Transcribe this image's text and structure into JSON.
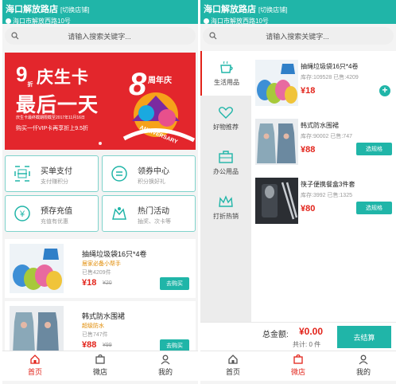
{
  "colors": {
    "brand": "#20b5a8",
    "price": "#e2231a",
    "banner": "#e3262c"
  },
  "left": {
    "header": {
      "title": "海口解放路店",
      "switch_label": "[切换店铺]",
      "address": "海口市解放西路10号"
    },
    "search": {
      "placeholder": "请输入搜索关键字..."
    },
    "banner": {
      "num": "9",
      "num_unit": "折",
      "line1": "庆生卡",
      "line2": "最后一天",
      "fine_print": "庆生卡最终截期限截至2017年11月16日",
      "promo": "购买一仟VIP卡再享折上9.5折",
      "anniv_num": "8",
      "anniv_text": "周年庆",
      "anniv_en": "ANNIVERSARY"
    },
    "tiles": [
      {
        "name": "买单支付",
        "sub": "支付赚积分",
        "icon": "scan-pay-icon"
      },
      {
        "name": "领券中心",
        "sub": "积分换好礼",
        "icon": "coupon-icon"
      },
      {
        "name": "预存充值",
        "sub": "充值有优惠",
        "icon": "recharge-icon"
      },
      {
        "name": "热门活动",
        "sub": "抽奖、次卡等",
        "icon": "activity-icon"
      }
    ],
    "products": [
      {
        "name": "抽绳垃圾袋16只*4卷",
        "tag": "居家必备小帮手",
        "sold": "已售4209件",
        "price": "¥18",
        "original_price": "¥20",
        "button": "去购买"
      },
      {
        "name": "韩式防水围裙",
        "tag": "超级防水",
        "sold": "已售747件",
        "price": "¥88",
        "original_price": "¥99",
        "button": "去购买"
      }
    ],
    "tabbar": [
      {
        "label": "首页",
        "icon": "home-icon",
        "active": true
      },
      {
        "label": "微店",
        "icon": "shop-icon",
        "active": false
      },
      {
        "label": "我的",
        "icon": "user-icon",
        "active": false
      }
    ]
  },
  "right": {
    "header": {
      "title": "海口解放路店",
      "switch_label": "[切换店铺]",
      "address": "海口市解放西路10号"
    },
    "search": {
      "placeholder": "请输入搜索关键字..."
    },
    "categories": [
      {
        "label": "生活用品",
        "icon": "cup-icon",
        "active": true
      },
      {
        "label": "好物推荐",
        "icon": "heart-icon",
        "active": false
      },
      {
        "label": "办公用品",
        "icon": "briefcase-icon",
        "active": false
      },
      {
        "label": "打折热销",
        "icon": "crown-icon",
        "active": false
      }
    ],
    "products": [
      {
        "name": "抽绳垃圾袋16只*4卷",
        "stock": "库存:109528 已售:4209",
        "price": "¥18",
        "action": "+"
      },
      {
        "name": "韩式防水围裙",
        "stock": "库存:90002 已售:747",
        "price": "¥88",
        "action": "选规格"
      },
      {
        "name": "筷子便携餐盒3件套",
        "stock": "库存:3992 已售:1325",
        "price": "¥80",
        "action": "选规格"
      }
    ],
    "cart": {
      "total_label": "总金额:",
      "total_value": "¥0.00",
      "count_text": "共计: 0 件",
      "checkout": "去结算"
    },
    "tabbar": [
      {
        "label": "首页",
        "icon": "home-icon",
        "active": false
      },
      {
        "label": "微店",
        "icon": "shop-icon",
        "active": true
      },
      {
        "label": "我的",
        "icon": "user-icon",
        "active": false
      }
    ]
  }
}
